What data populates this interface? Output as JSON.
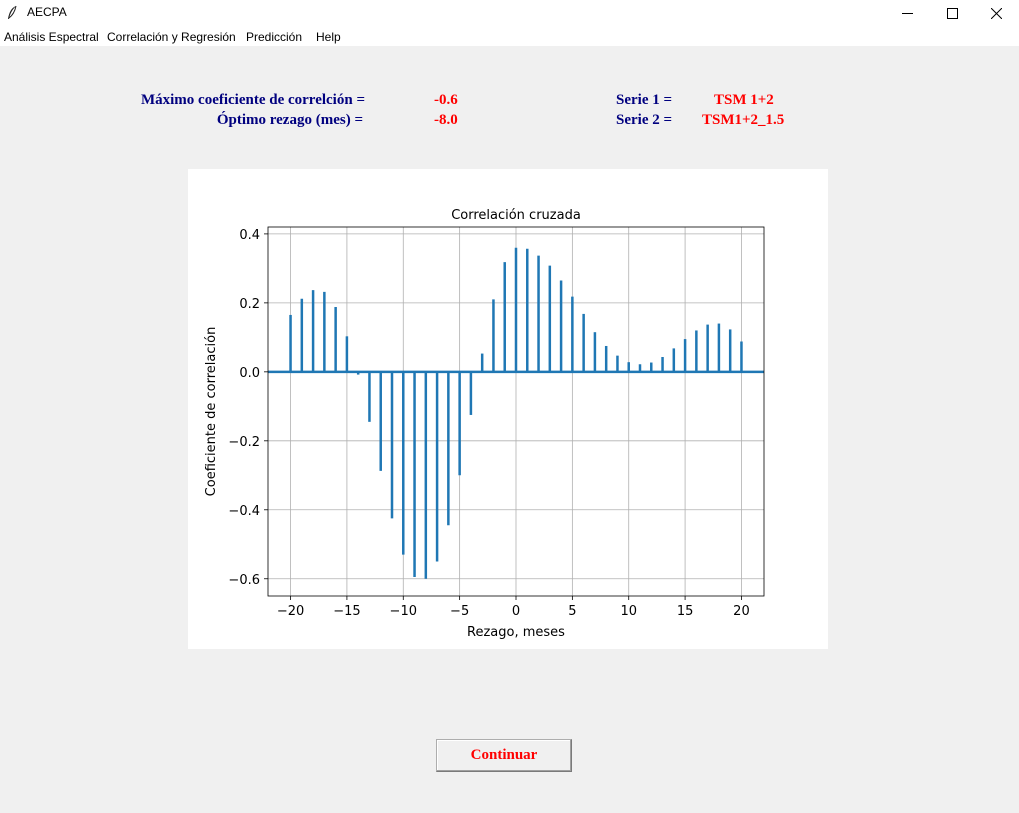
{
  "window": {
    "title": "AECPA",
    "controls": [
      "minimize-icon",
      "maximize-icon",
      "close-icon"
    ]
  },
  "menu": {
    "items": [
      "Análisis Espectral",
      "Correlación y Regresión",
      "Predicción",
      "Help"
    ]
  },
  "summary": {
    "max_coef_label": "Máximo coeficiente de correlción =",
    "max_coef_value": "-0.6",
    "lag_label": "Óptimo rezago (mes) =",
    "lag_value": "-8.0",
    "serie1_label": "Serie 1 =",
    "serie1_value": "TSM 1+2",
    "serie2_label": "Serie 2 =",
    "serie2_value": "TSM1+2_1.5"
  },
  "colors": {
    "label": "#00007f",
    "value": "#ff0000",
    "bar": "#1f77b4"
  },
  "chart_data": {
    "type": "bar",
    "title": "Correlación cruzada",
    "xlabel": "Rezago, meses",
    "ylabel": "Coeficiente de correlación",
    "x": [
      -20,
      -19,
      -18,
      -17,
      -16,
      -15,
      -14,
      -13,
      -12,
      -11,
      -10,
      -9,
      -8,
      -7,
      -6,
      -5,
      -4,
      -3,
      -2,
      -1,
      0,
      1,
      2,
      3,
      4,
      5,
      6,
      7,
      8,
      9,
      10,
      11,
      12,
      13,
      14,
      15,
      16,
      17,
      18,
      19,
      20
    ],
    "values": [
      0.165,
      0.212,
      0.237,
      0.232,
      0.188,
      0.103,
      -0.008,
      -0.145,
      -0.287,
      -0.425,
      -0.53,
      -0.595,
      -0.6,
      -0.55,
      -0.445,
      -0.3,
      -0.125,
      0.053,
      0.21,
      0.318,
      0.36,
      0.357,
      0.337,
      0.308,
      0.265,
      0.218,
      0.168,
      0.115,
      0.075,
      0.047,
      0.028,
      0.022,
      0.027,
      0.043,
      0.068,
      0.095,
      0.12,
      0.137,
      0.14,
      0.123,
      0.088
    ],
    "xlim": [
      -22,
      22
    ],
    "ylim": [
      -0.65,
      0.42
    ],
    "xticks": [
      -20,
      -15,
      -10,
      -5,
      0,
      5,
      10,
      15,
      20
    ],
    "xtick_labels": [
      "−20",
      "−15",
      "−10",
      "−5",
      "0",
      "5",
      "10",
      "15",
      "20"
    ],
    "yticks": [
      -0.6,
      -0.4,
      -0.2,
      0.0,
      0.2,
      0.4
    ],
    "ytick_labels": [
      "−0.6",
      "−0.4",
      "−0.2",
      "0.0",
      "0.2",
      "0.4"
    ],
    "grid": true,
    "zero_line": true
  },
  "buttons": {
    "continue_label": "Continuar"
  }
}
